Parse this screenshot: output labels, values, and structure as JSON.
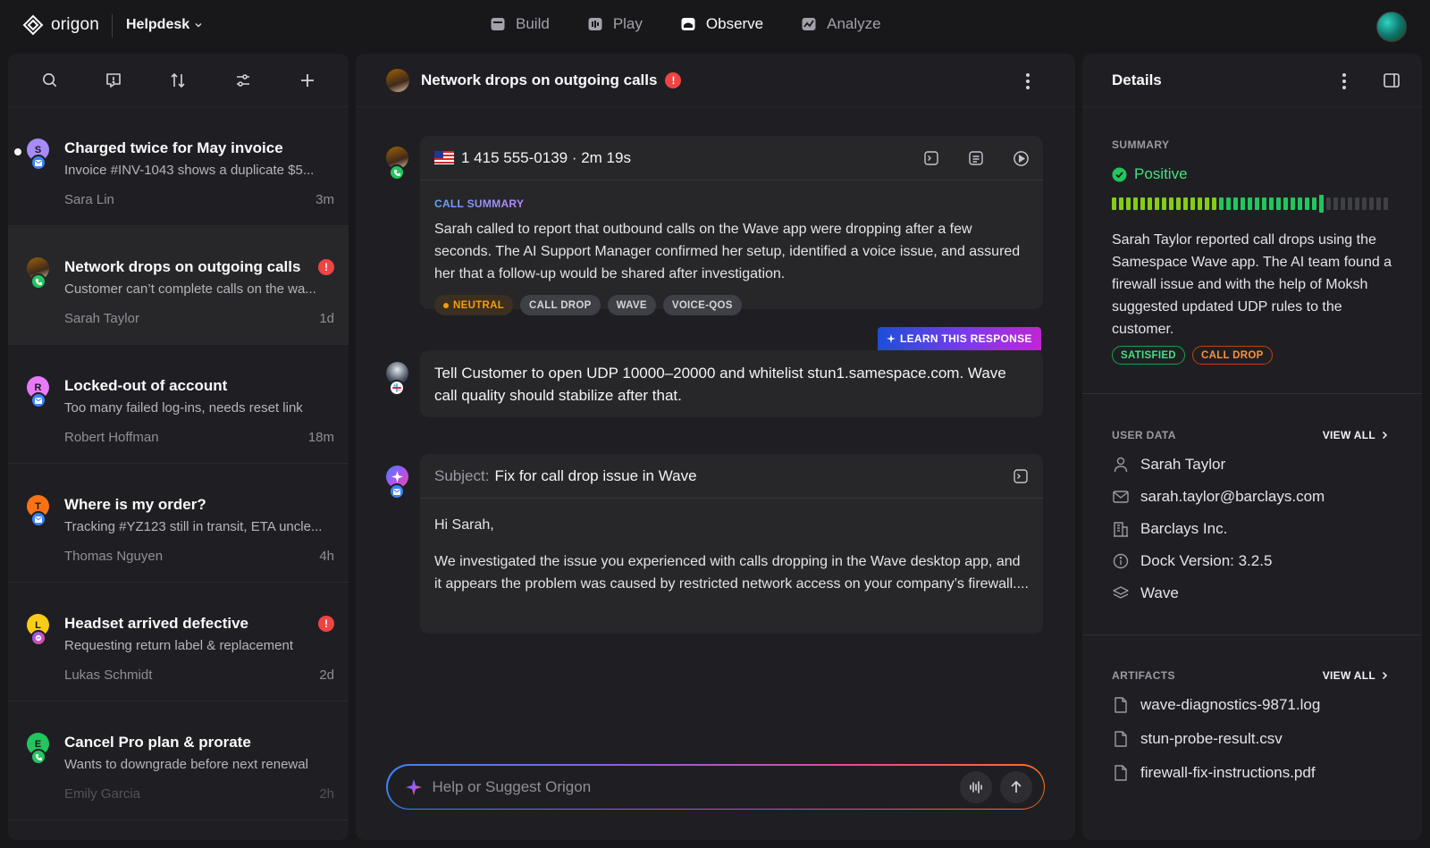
{
  "brand": {
    "name": "origon",
    "workspace": "Helpdesk"
  },
  "nav": [
    {
      "label": "Build",
      "icon": "build-icon"
    },
    {
      "label": "Play",
      "icon": "play-icon"
    },
    {
      "label": "Observe",
      "icon": "observe-icon",
      "active": true
    },
    {
      "label": "Analyze",
      "icon": "analyze-icon"
    }
  ],
  "conversations": [
    {
      "title": "Charged twice for May invoice",
      "preview": "Invoice #INV-1043 shows a duplicate $5...",
      "name": "Sara Lin",
      "time": "3m",
      "initial": "S",
      "avatar_color": "#a78bfa",
      "channel": "email",
      "unread": true
    },
    {
      "title": "Network drops on outgoing calls",
      "preview": "Customer can’t complete calls on the wa...",
      "name": "Sarah Taylor",
      "time": "1d",
      "initial": "",
      "channel": "phone",
      "alert": "!",
      "selected": true
    },
    {
      "title": "Locked-out of account",
      "preview": "Too many failed log-ins, needs reset link",
      "name": "Robert Hoffman",
      "time": "18m",
      "initial": "R",
      "avatar_color": "#e879f9",
      "channel": "email"
    },
    {
      "title": "Where is my order?",
      "preview": "Tracking #YZ123 still in transit, ETA uncle...",
      "name": "Thomas Nguyen",
      "time": "4h",
      "initial": "T",
      "avatar_color": "#f97316",
      "channel": "email"
    },
    {
      "title": "Headset arrived defective",
      "preview": "Requesting return label & replacement",
      "name": "Lukas Schmidt",
      "time": "2d",
      "initial": "L",
      "avatar_color": "#facc15",
      "channel": "messenger",
      "alert": "!"
    },
    {
      "title": "Cancel Pro plan & prorate",
      "preview": "Wants to downgrade before next renewal",
      "name": "Emily Garcia",
      "time": "2h",
      "initial": "E",
      "avatar_color": "#22c55e",
      "channel": "phone",
      "faded": true
    }
  ],
  "thread": {
    "title": "Network drops on outgoing calls",
    "alert": "!",
    "call": {
      "number": "1 415 555-0139 · 2m 19s",
      "summary_label": "CALL SUMMARY",
      "summary": "Sarah called to report that outbound calls on the Wave app were dropping after a few seconds. The AI Support Manager confirmed her setup, identified a voice issue, and assured her that a follow-up would be shared after investigation.",
      "chips": [
        "NEUTRAL",
        "CALL DROP",
        "WAVE",
        "VOICE-QOS"
      ]
    },
    "learn_button": "LEARN THIS RESPONSE",
    "reply": "Tell Customer to open UDP 10000–20000 and whitelist stun1.samespace.com. Wave call quality should stabilize after that.",
    "email": {
      "subject_label": "Subject:",
      "subject": "Fix for call drop issue in Wave",
      "greeting": "Hi Sarah,",
      "body": "We investigated the issue you experienced with calls dropping in the Wave desktop app, and it appears the problem was caused by restricted network access on your company’s firewall...."
    },
    "composer_placeholder": "Help or Suggest Origon"
  },
  "details": {
    "title": "Details",
    "summary_label": "SUMMARY",
    "sentiment": "Positive",
    "sentiment_level": 0.78,
    "summary": "Sarah Taylor reported call drops using the Samespace Wave app. The AI team found a firewall issue and with the help of Moksh suggested updated UDP rules to the customer.",
    "tags": [
      "SATISFIED",
      "CALL DROP"
    ],
    "user_label": "USER DATA",
    "view_all": "VIEW ALL",
    "user": [
      {
        "icon": "user-icon",
        "value": "Sarah Taylor"
      },
      {
        "icon": "mail-icon",
        "value": "sarah.taylor@barclays.com"
      },
      {
        "icon": "building-icon",
        "value": "Barclays Inc."
      },
      {
        "icon": "info-icon",
        "value": "Dock Version: 3.2.5"
      },
      {
        "icon": "layers-icon",
        "value": "Wave"
      }
    ],
    "artifacts_label": "ARTIFACTS",
    "artifacts": [
      "wave-diagnostics-9871.log",
      "stun-probe-result.csv",
      "firewall-fix-instructions.pdf"
    ]
  },
  "colors": {
    "positive": "#4ade80",
    "alert": "#ef4444",
    "neutral": "#f59e0b",
    "drop": "#fb923c"
  }
}
